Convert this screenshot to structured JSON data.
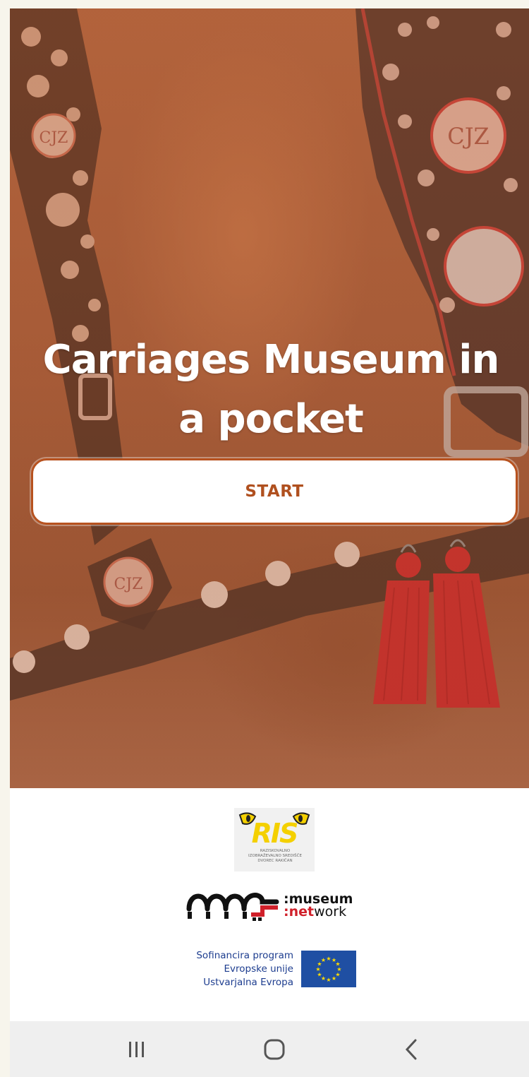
{
  "app": {
    "title": "Carriages Museum in a pocket",
    "start_label": "START"
  },
  "hero_image": {
    "emblem_text": "CJZ",
    "hero_tint_color": "#cd5f28",
    "tassel_color": "#c0282d"
  },
  "logos": {
    "ris": {
      "name": "RIS",
      "subtitle": "RAZISKOVALNO IZOBRAŽEVALNO SREDIŠČE DVOREC RAKIČAN"
    },
    "museum_network": {
      "line1_prefix": ":",
      "line1": "museum",
      "line2_red": ":net",
      "line2": "work"
    },
    "eu": {
      "lines": [
        "Sofinancira program",
        "Evropske unije",
        "Ustvarjalna Evropa"
      ],
      "flag_color": "#1f4fa3",
      "star_color": "#ffdd00"
    }
  },
  "navbar": {
    "recent_icon": "recent-apps-icon",
    "home_icon": "home-icon",
    "back_icon": "back-icon"
  },
  "colors": {
    "accent": "#b7521f",
    "button_text": "#b0501f",
    "navbar_bg": "#efefef"
  }
}
